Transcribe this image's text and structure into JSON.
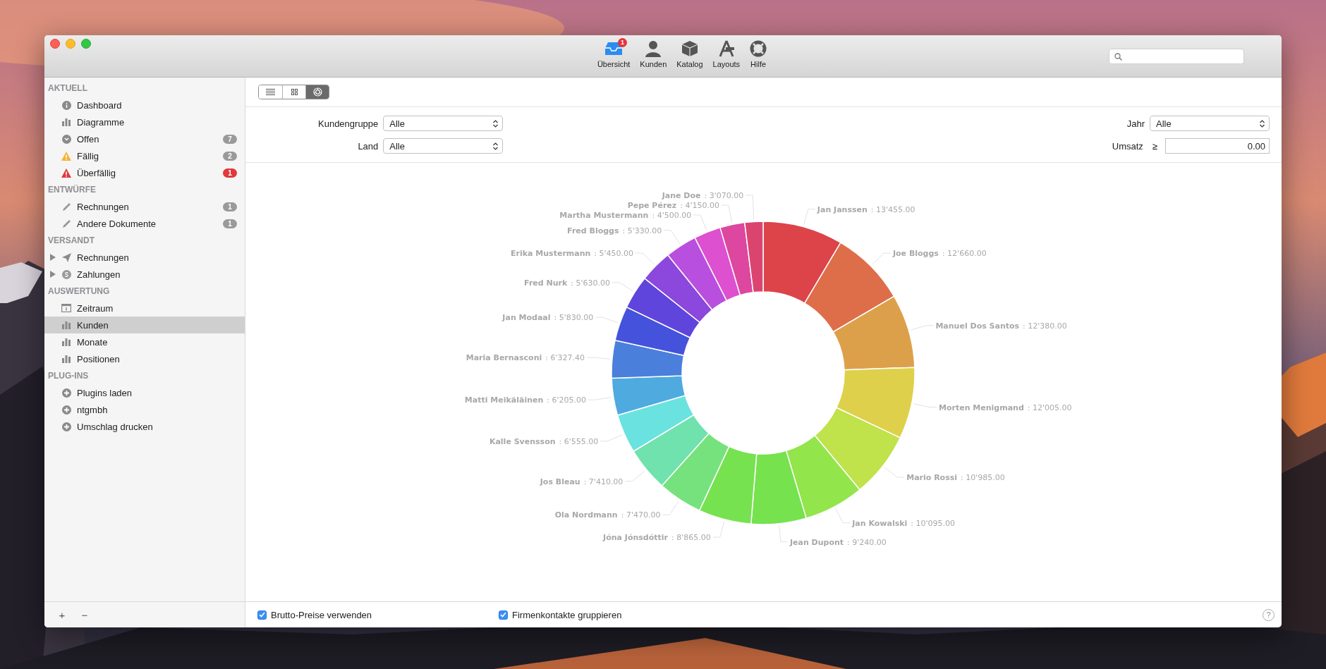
{
  "toolbar": {
    "items": [
      {
        "label": "Übersicht",
        "kind": "inbox",
        "badge": "1"
      },
      {
        "label": "Kunden",
        "kind": "person"
      },
      {
        "label": "Katalog",
        "kind": "box"
      },
      {
        "label": "Layouts",
        "kind": "layout"
      },
      {
        "label": "Hilfe",
        "kind": "lifebuoy"
      }
    ]
  },
  "sidebar": {
    "sections": [
      {
        "title": "AKTUELL",
        "items": [
          {
            "label": "Dashboard",
            "kind": "info",
            "selected": false
          },
          {
            "label": "Diagramme",
            "kind": "chart",
            "selected": false
          },
          {
            "label": "Offen",
            "kind": "clock",
            "selected": false,
            "badge": {
              "text": "7",
              "color": "#9a9a9a"
            }
          },
          {
            "label": "Fällig",
            "kind": "warning",
            "selected": false,
            "badge": {
              "text": "2",
              "color": "#9a9a9a"
            }
          },
          {
            "label": "Überfällig",
            "kind": "error",
            "selected": false,
            "badge": {
              "text": "1",
              "color": "#e0393e"
            }
          }
        ]
      },
      {
        "title": "ENTWÜRFE",
        "items": [
          {
            "label": "Rechnungen",
            "kind": "pencil",
            "selected": false,
            "badge": {
              "text": "1",
              "color": "#9a9a9a"
            }
          },
          {
            "label": "Andere Dokumente",
            "kind": "pencil",
            "selected": false,
            "badge": {
              "text": "1",
              "color": "#9a9a9a"
            }
          }
        ]
      },
      {
        "title": "VERSANDT",
        "items": [
          {
            "label": "Rechnungen",
            "kind": "send",
            "selected": false,
            "expanded": false
          },
          {
            "label": "Zahlungen",
            "kind": "coin",
            "selected": false,
            "expanded": false
          }
        ]
      },
      {
        "title": "AUSWERTUNG",
        "items": [
          {
            "label": "Zeitraum",
            "kind": "calendar",
            "selected": false
          },
          {
            "label": "Kunden",
            "kind": "chart",
            "selected": true
          },
          {
            "label": "Monate",
            "kind": "chart",
            "selected": false
          },
          {
            "label": "Positionen",
            "kind": "chart",
            "selected": false
          }
        ]
      },
      {
        "title": "PLUG-INS",
        "items": [
          {
            "label": "Plugins laden",
            "kind": "plus",
            "selected": false
          },
          {
            "label": "ntgmbh",
            "kind": "plus",
            "selected": false
          },
          {
            "label": "Umschlag drucken",
            "kind": "plus",
            "selected": false
          }
        ]
      }
    ],
    "footer_buttons": [
      "+",
      "−"
    ]
  },
  "view_switcher": [
    {
      "kind": "list",
      "selected": false
    },
    {
      "kind": "grid",
      "selected": false
    },
    {
      "kind": "chart",
      "selected": true
    }
  ],
  "filters": {
    "left": [
      {
        "label": "Kundengruppe",
        "value": "Alle"
      },
      {
        "label": "Land",
        "value": "Alle"
      }
    ],
    "year": {
      "label": "Jahr",
      "value": "Alle"
    },
    "revenue": {
      "label": "Umsatz",
      "operator": "≥",
      "value": "0.00"
    }
  },
  "chart_data": {
    "type": "donut",
    "categories": [
      "Jan Janssen",
      "Joe Bloggs",
      "Manuel Dos Santos",
      "Morten Menigmand",
      "Mario Rossi",
      "Jan Kowalski",
      "Jean Dupont",
      "Jóna Jónsdóttir",
      "Ola Nordmann",
      "Jos Bleau",
      "Kalle Svensson",
      "Matti Meikäläinen",
      "Maria Bernasconi",
      "Jan Modaal",
      "Fred Nurk",
      "Erika Mustermann",
      "Fred Bloggs",
      "Martha Mustermann",
      "Pepe Pérez",
      "Jane Doe"
    ],
    "values": [
      13455,
      12660,
      12380,
      12005,
      10985,
      10095,
      9240,
      8865,
      7470,
      7410,
      6555,
      6205,
      6327.4,
      5830,
      5630,
      5450,
      5330,
      4500,
      4150,
      3070
    ],
    "value_labels": [
      ": 13'455.00",
      ": 12'660.00",
      ": 12'380.00",
      ": 12'005.00",
      ": 10'985.00",
      ": 10'095.00",
      ": 9'240.00",
      ": 8'865.00",
      ": 7'470.00",
      ": 7'410.00",
      ": 6'555.00",
      ": 6'205.00",
      ": 6'327.40",
      ": 5'830.00",
      ": 5'630.00",
      ": 5'450.00",
      ": 5'330.00",
      ": 4'500.00",
      ": 4'150.00",
      ": 3'070.00"
    ],
    "colors": [
      "#dc4449",
      "#de6e4a",
      "#dda04a",
      "#dfd04b",
      "#c0e24b",
      "#92e54b",
      "#76e24e",
      "#77e250",
      "#76e27e",
      "#6fe2ad",
      "#6ae2df",
      "#4eaadf",
      "#4a7fdc",
      "#4552dc",
      "#6045dc",
      "#8c47dc",
      "#b94fdf",
      "#dd50cf",
      "#dd47a0",
      "#dc4470"
    ]
  },
  "options": [
    {
      "label": "Brutto-Preise verwenden",
      "checked": true
    },
    {
      "label": "Firmenkontakte gruppieren",
      "checked": true
    }
  ],
  "help_button": "?"
}
